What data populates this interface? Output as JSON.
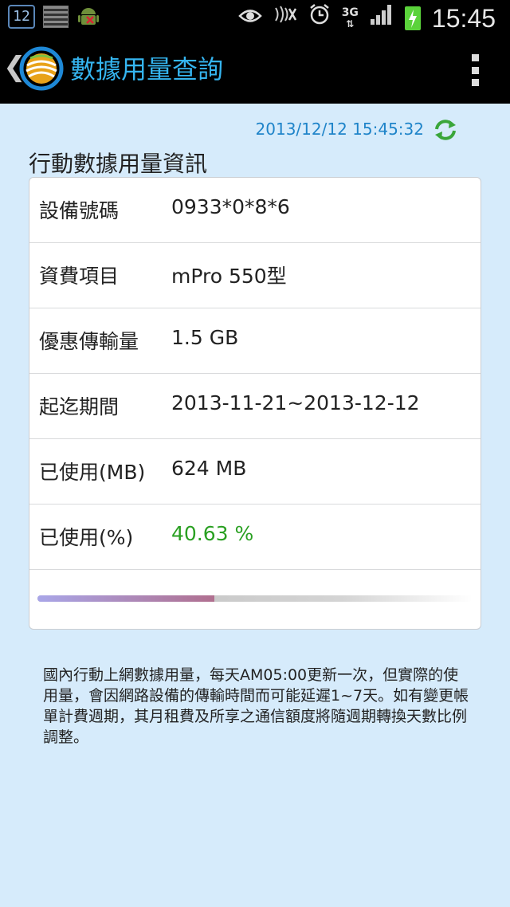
{
  "status_bar": {
    "calendar_day": "12",
    "network": "3G",
    "time": "15:45",
    "icons": [
      "calendar-icon",
      "notes-icon",
      "android-icon",
      "eye-icon",
      "mute-icon",
      "alarm-icon",
      "3g-icon",
      "signal-icon",
      "battery-icon"
    ]
  },
  "action_bar": {
    "back_glyph": "❮",
    "title": "數據用量查詢"
  },
  "header": {
    "timestamp": "2013/12/12 15:45:32",
    "section_title": "行動數據用量資訊"
  },
  "rows": [
    {
      "label": "設備號碼",
      "value": "0933*0*8*6"
    },
    {
      "label": "資費項目",
      "value": "mPro 550型"
    },
    {
      "label": "優惠傳輸量",
      "value": "1.5 GB"
    },
    {
      "label": "起迄期間",
      "value": "2013-11-21~2013-12-12"
    },
    {
      "label": "已使用(MB)",
      "value": "624 MB"
    },
    {
      "label": "已使用(%)",
      "value": "40.63 %"
    }
  ],
  "usage": {
    "percent": 40.63
  },
  "colors": {
    "background": "#d6ebfb",
    "accent": "#35b5f0",
    "percent_value": "#2aa022",
    "timestamp": "#1f84c9"
  },
  "note": "國內行動上網數據用量，每天AM05:00更新一次，但實際的使用量，會因網路設備的傳輸時間而可能延遲1~7天。如有變更帳單計費週期，其月租費及所享之通信額度將隨週期轉換天數比例調整。"
}
